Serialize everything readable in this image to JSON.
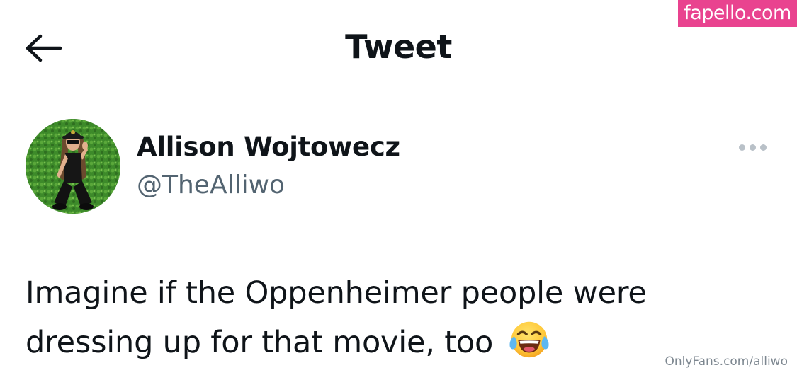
{
  "header": {
    "title": "Tweet",
    "back_icon": "arrow-left-icon"
  },
  "watermark": {
    "text": "fapello.com",
    "color": "#e9438f"
  },
  "author": {
    "name": "Allison Wojtowecz",
    "handle": "@TheAlliwo",
    "avatar_icon": "avatar-photo",
    "more_icon": "more-horizontal-icon"
  },
  "tweet": {
    "line1": "Imagine if the Oppenheimer people were",
    "line2": "dressing up for that movie, too",
    "emoji_icon": "tears-of-joy-emoji"
  },
  "footer": {
    "credit": "OnlyFans.com/alliwo"
  },
  "colors": {
    "text_primary": "#0f1419",
    "text_secondary": "#536471",
    "more_dots": "#b9c1c8"
  }
}
